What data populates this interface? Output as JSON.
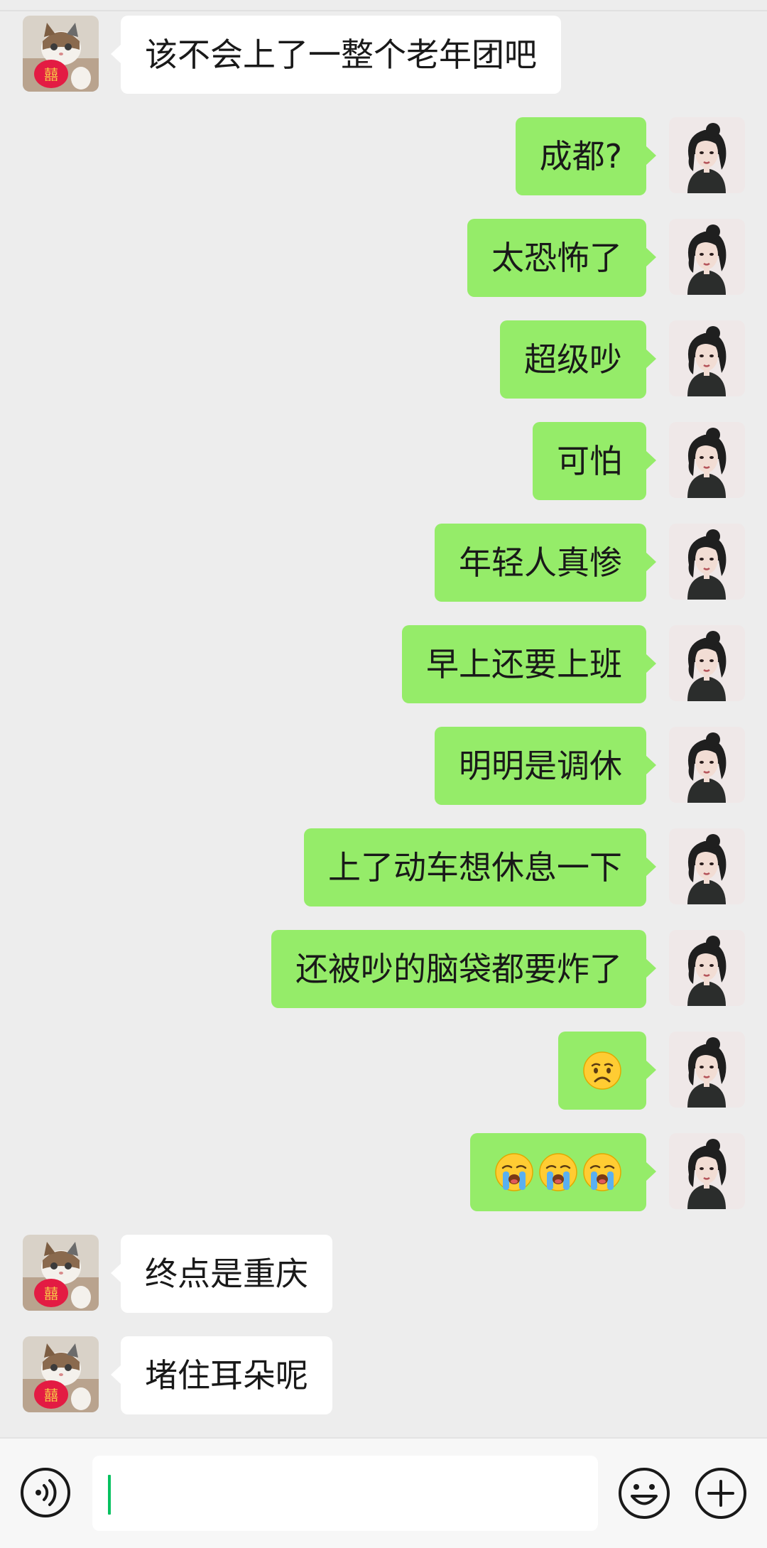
{
  "conversation": {
    "messages": [
      {
        "side": "left",
        "text": "该不会上了一整个老年团吧"
      },
      {
        "side": "right",
        "text": "成都?"
      },
      {
        "side": "right",
        "text": "太恐怖了"
      },
      {
        "side": "right",
        "text": "超级吵"
      },
      {
        "side": "right",
        "text": "可怕"
      },
      {
        "side": "right",
        "text": "年轻人真惨"
      },
      {
        "side": "right",
        "text": "早上还要上班"
      },
      {
        "side": "right",
        "text": "明明是调休"
      },
      {
        "side": "right",
        "text": "上了动车想休息一下"
      },
      {
        "side": "right",
        "text": "还被吵的脑袋都要炸了"
      },
      {
        "side": "right",
        "emojis": [
          "frowning-face-emoji"
        ]
      },
      {
        "side": "right",
        "emojis": [
          "loudly-crying-face-emoji",
          "loudly-crying-face-emoji",
          "loudly-crying-face-emoji"
        ]
      },
      {
        "side": "left",
        "text": "终点是重庆"
      },
      {
        "side": "left",
        "text": "堵住耳朵呢"
      }
    ]
  },
  "input_bar": {
    "voice_icon": "voice-icon",
    "input_value": "",
    "emoji_icon": "smile-icon",
    "more_icon": "plus-icon"
  },
  "colors": {
    "background": "#ededed",
    "sent_bubble": "#95ec69",
    "received_bubble": "#ffffff",
    "caret": "#07c160"
  }
}
